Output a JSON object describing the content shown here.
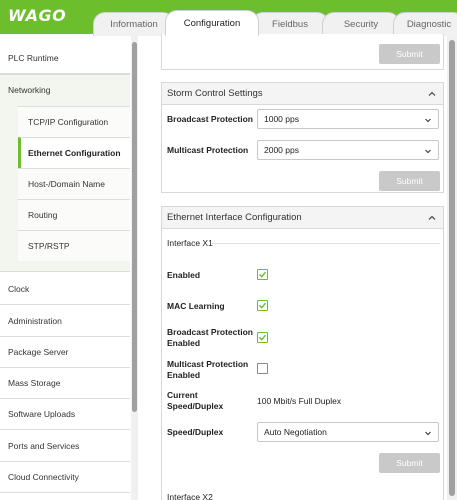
{
  "brand": {
    "logo": "WAGO"
  },
  "tabs": [
    {
      "label": "Information",
      "active": false
    },
    {
      "label": "Configuration",
      "active": true
    },
    {
      "label": "Fieldbus",
      "active": false
    },
    {
      "label": "Security",
      "active": false
    },
    {
      "label": "Diagnostic",
      "active": false
    }
  ],
  "sidebar": {
    "plc_runtime": "PLC Runtime",
    "networking": "Networking",
    "networking_items": [
      {
        "label": "TCP/IP Configuration",
        "active": false
      },
      {
        "label": "Ethernet Configuration",
        "active": true
      },
      {
        "label": "Host-/Domain Name",
        "active": false
      },
      {
        "label": "Routing",
        "active": false
      },
      {
        "label": "STP/RSTP",
        "active": false
      }
    ],
    "items": [
      {
        "label": "Clock"
      },
      {
        "label": "Administration"
      },
      {
        "label": "Package Server"
      },
      {
        "label": "Mass Storage"
      },
      {
        "label": "Software Uploads"
      },
      {
        "label": "Ports and Services"
      },
      {
        "label": "Cloud Connectivity"
      }
    ]
  },
  "top_panel": {
    "submit_label": "Submit"
  },
  "storm_panel": {
    "title": "Storm Control Settings",
    "broadcast_label": "Broadcast Protection",
    "broadcast_value": "1000 pps",
    "multicast_label": "Multicast Protection",
    "multicast_value": "2000 pps",
    "submit_label": "Submit"
  },
  "eth_panel": {
    "title": "Ethernet Interface Configuration",
    "interface_x1": "Interface X1",
    "enabled_label": "Enabled",
    "enabled_checked": true,
    "mac_label": "MAC Learning",
    "mac_checked": true,
    "bcast_label_1": "Broadcast Protection",
    "bcast_label_2": "Enabled",
    "bcast_checked": true,
    "mcast_label_1": "Multicast Protection",
    "mcast_label_2": "Enabled",
    "mcast_checked": false,
    "current_label_1": "Current",
    "current_label_2": "Speed/Duplex",
    "current_value": "100 Mbit/s Full Duplex",
    "speed_label": "Speed/Duplex",
    "speed_value": "Auto Negotiation",
    "submit_label": "Submit",
    "interface_x2": "Interface X2"
  },
  "colors": {
    "brand_green": "#6cbe2d",
    "disabled_button": "#c9c9c9"
  },
  "icons": [
    "chevron-up-icon",
    "chevron-down-icon",
    "checkmark-icon"
  ]
}
